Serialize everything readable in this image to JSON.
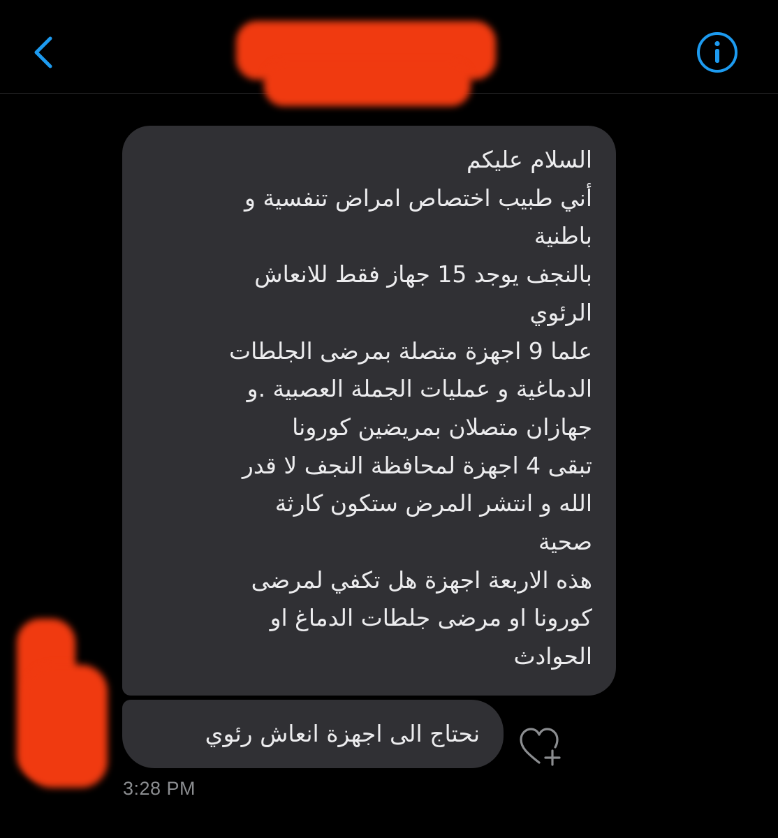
{
  "header": {
    "back_icon": "chevron-left-icon",
    "info_icon": "info-circle-icon",
    "accent_color": "#1d9bf0"
  },
  "messages": [
    {
      "lines": [
        "السلام عليكم",
        "أني طبيب اختصاص امراض تنفسية و",
        "باطنية",
        "بالنجف يوجد 15 جهاز فقط  للانعاش",
        "الرئوي",
        "علما 9 اجهزة متصلة بمرضى الجلطات",
        "الدماغية و عمليات الجملة العصبية .و",
        "جهازان متصلان بمريضين كورونا",
        "تبقى 4 اجهزة لمحافظة النجف لا قدر",
        "الله و انتشر المرض ستكون كارثة",
        "صحية",
        " هذه الاربعة اجهزة هل تكفي لمرضى",
        "كورونا او مرضى جلطات الدماغ او",
        "الحوادث"
      ]
    },
    {
      "text": "نحتاج الى اجهزة انعاش رئوي"
    }
  ],
  "reaction_icon": "heart-plus-icon",
  "timestamp": "3:28 PM",
  "colors": {
    "background": "#000000",
    "bubble": "#303034",
    "redaction": "#f03a10",
    "timestamp": "#8b8d90"
  }
}
